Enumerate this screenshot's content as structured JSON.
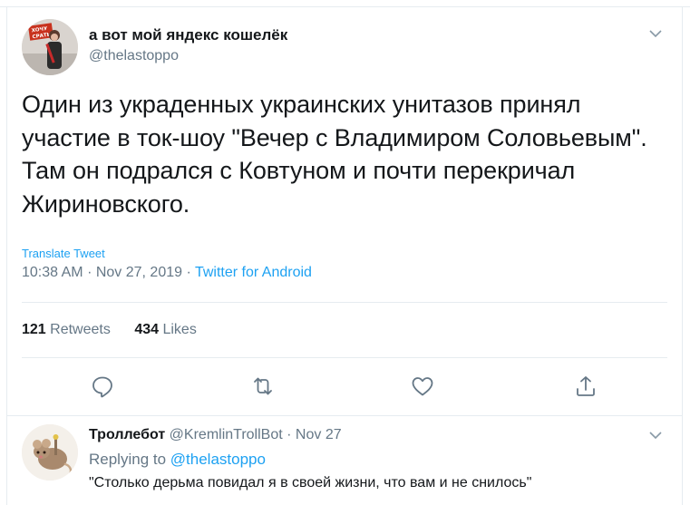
{
  "tweet": {
    "display_name": "а вот мой яндекс кошелёк",
    "handle": "@thelastoppo",
    "text": "Один из украденных украинских унитазов принял участие в ток-шоу \"Вечер с Владимиром Соловьевым\". Там он подрался с Ковтуном и почти перекричал Жириновского.",
    "translate_label": "Translate Tweet",
    "time": "10:38 AM",
    "date": "Nov 27, 2019",
    "separator": "·",
    "source": "Twitter for Android",
    "retweets_count": "121",
    "retweets_label": "Retweets",
    "likes_count": "434",
    "likes_label": "Likes"
  },
  "avatar_sign_text": "ХОЧУ СРАТЬ",
  "actions": {
    "reply_icon": "reply-icon",
    "retweet_icon": "retweet-icon",
    "like_icon": "heart-icon",
    "share_icon": "share-icon",
    "menu_icon": "chevron-down-icon"
  },
  "reply": {
    "display_name": "Троллебот",
    "handle": "@KremlinTrollBot",
    "separator": "·",
    "date": "Nov 27",
    "replying_prefix": "Replying to",
    "replying_mention": "@thelastoppo",
    "text": "\"Столько дерьма повидал я в своей жизни, что вам и не снилось\""
  },
  "colors": {
    "text": "#14171a",
    "secondary": "#657786",
    "accent": "#1da1f2",
    "border": "#e6ecf0"
  }
}
